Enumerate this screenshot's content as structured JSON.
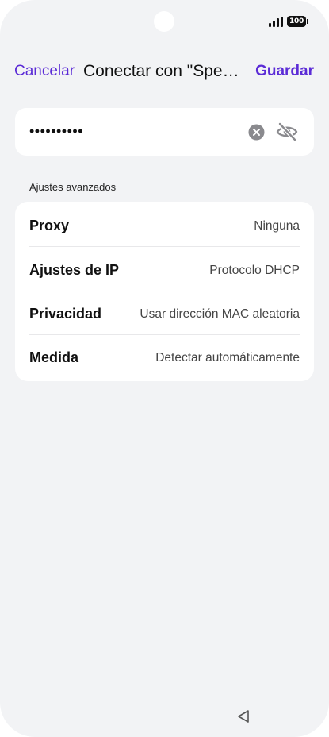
{
  "status_bar": {
    "battery_level": "100",
    "signal_icon": "signal-bars-icon",
    "camera_icon": "camera-cutout"
  },
  "header": {
    "cancel_label": "Cancelar",
    "title": "Conectar con \"Spee...",
    "save_label": "Guardar"
  },
  "password": {
    "value": "••••••••••",
    "clear_icon": "clear-circle-icon",
    "visibility_icon": "eye-off-icon"
  },
  "advanced": {
    "section_label": "Ajustes avanzados",
    "rows": [
      {
        "label": "Proxy",
        "value": "Ninguna"
      },
      {
        "label": "Ajustes de IP",
        "value": "Protocolo DHCP"
      },
      {
        "label": "Privacidad",
        "value": "Usar dirección MAC aleatoria"
      },
      {
        "label": "Medida",
        "value": "Detectar automáticamente"
      }
    ]
  },
  "nav": {
    "back_icon": "back-triangle-icon"
  },
  "colors": {
    "accent": "#5b2bd6",
    "background": "#f2f3f5",
    "card": "#ffffff"
  }
}
